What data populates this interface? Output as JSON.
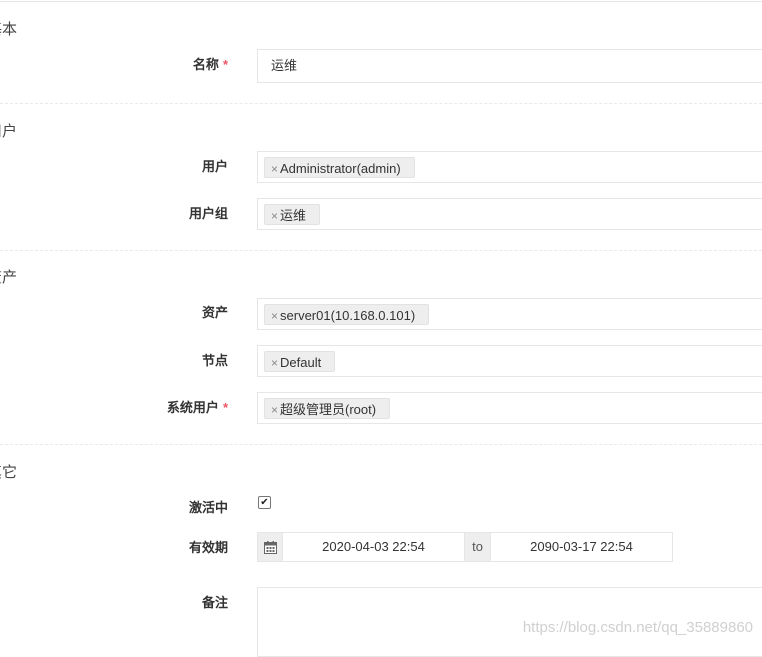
{
  "sections": {
    "basic": "基本",
    "user": "用户",
    "asset": "资产",
    "other": "其它"
  },
  "fields": {
    "name": {
      "label": "名称",
      "required_mark": "*",
      "value": "运维"
    },
    "users": {
      "label": "用户",
      "tags": [
        "Administrator(admin)"
      ]
    },
    "user_groups": {
      "label": "用户组",
      "tags": [
        "运维"
      ]
    },
    "assets": {
      "label": "资产",
      "tags": [
        "server01(10.168.0.101)"
      ]
    },
    "nodes": {
      "label": "节点",
      "tags": [
        "Default"
      ]
    },
    "system_users": {
      "label": "系统用户",
      "required_mark": "*",
      "tags": [
        "超级管理员(root)"
      ]
    },
    "active": {
      "label": "激活中",
      "checked": true,
      "check_glyph": "✔"
    },
    "validity": {
      "label": "有效期",
      "start": "2020-04-03 22:54",
      "separator": "to",
      "end": "2090-03-17 22:54"
    },
    "comment": {
      "label": "备注",
      "value": ""
    }
  },
  "tag_remove_glyph": "×",
  "watermark": "https://blog.csdn.net/qq_35889860"
}
